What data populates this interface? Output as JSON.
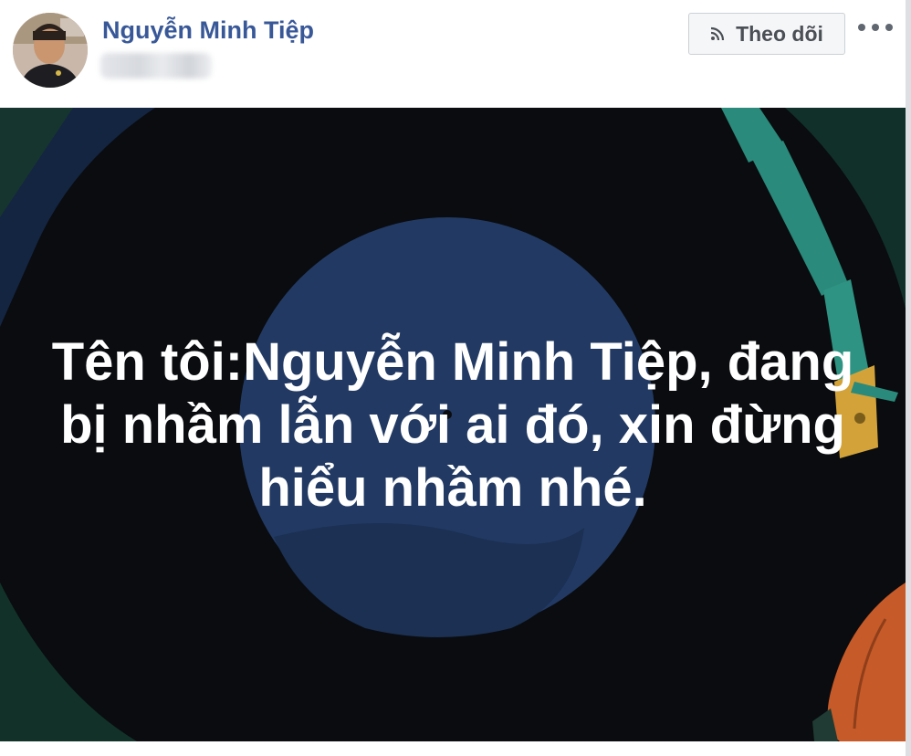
{
  "post": {
    "author_name": "Nguyễn Minh Tiệp",
    "follow_label": "Theo dõi",
    "status_text": "Tên tôi:Nguyễn Minh Tiệp, đang bị nhầm lẫn với ai đó, xin đừng hiểu nhầm nhé."
  },
  "icons": {
    "avatar": "profile-photo",
    "follow": "rss-icon",
    "more": "more-options-icon"
  },
  "colors": {
    "author_name": "#385898",
    "follow_button_bg": "#f5f6f7",
    "follow_button_border": "#ccd0d5",
    "background_card": "#0d0f12",
    "vinyl_center": "#223a63",
    "tonearm": "#2a8a7b",
    "accent_orange": "#c65a28"
  }
}
